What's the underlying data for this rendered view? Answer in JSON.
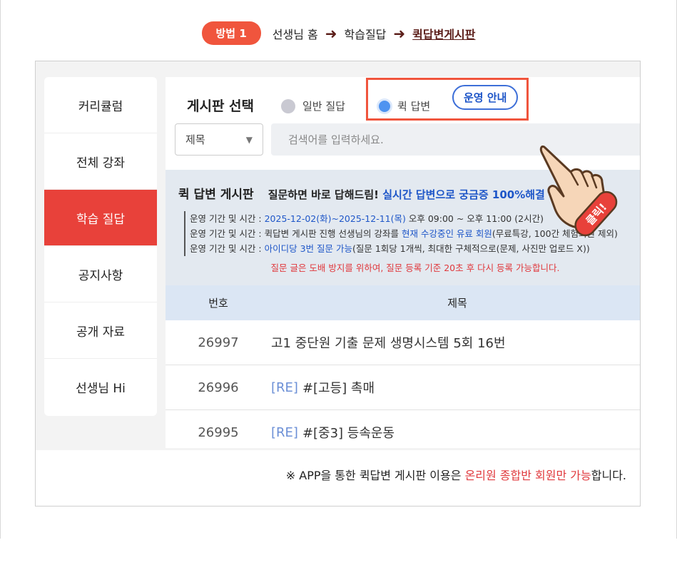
{
  "path": {
    "method_badge": "방법 1",
    "step1": "선생님 홈",
    "step2": "학습질답",
    "step3": "퀵답변게시판"
  },
  "sidebar": {
    "items": [
      {
        "label": "커리큘럼"
      },
      {
        "label": "전체 강좌"
      },
      {
        "label": "학습 질답"
      },
      {
        "label": "공지사항"
      },
      {
        "label": "공개 자료"
      },
      {
        "label": "선생님 Hi"
      }
    ]
  },
  "board_select": {
    "title": "게시판 선택",
    "radio_general": "일반 질답",
    "radio_quick": "퀵 답변",
    "guide_bubble": "운영 안내",
    "click_badge": "클릭!"
  },
  "search": {
    "field_value": "제목",
    "placeholder": "검색어를 입력하세요."
  },
  "info": {
    "title": "퀵 답변 게시판",
    "subtitle_plain": "질문하면 바로 답해드림!",
    "subtitle_blue": "실시간 답변으로 궁금증 100%해결",
    "line1_label": "운영 기간 및 시간 : ",
    "line1_blue": "2025-12-02(화)~2025-12-11(목)",
    "line1_rest": " 오후 09:00 ~ 오후 11:00 (2시간)",
    "line2_label": "운영 기간 및 시간 : ",
    "line2_plain": "퀵답변 게시판 진행 선생님의 강좌를 ",
    "line2_blue": "현재 수강중인 유료 회원",
    "line2_rest": "(무료특강, 100간 체험회원 제외)",
    "line3_label": "운영 기간 및 시간 : ",
    "line3_blue": "아이디당 3번 질문 가능",
    "line3_rest": "(질문 1회당 1개씩, 최대한 구체적으로(문제, 사진만 업로드 X))",
    "warning": "질문 글은 도배 방지를 위하여, 질문 등록 기준 20초 후 다시 등록 가능합니다."
  },
  "table": {
    "col_num": "번호",
    "col_title": "제목",
    "rows": [
      {
        "num": "26997",
        "prefix": "",
        "title": "고1 중단원 기출 문제 생명시스템 5회 16번"
      },
      {
        "num": "26996",
        "prefix": "[RE]",
        "title": "#[고등] 촉매"
      },
      {
        "num": "26995",
        "prefix": "[RE]",
        "title": "#[중3] 등속운동"
      }
    ]
  },
  "notice": {
    "prefix": "※ APP을 통한 퀵답변 게시판 이용은 ",
    "red": "온리원 종합반 회원만 가능",
    "suffix": "합니다."
  },
  "colors": {
    "accent_red": "#e8413a",
    "badge_orange": "#f0553d",
    "link_blue": "#1e56c8",
    "arrow_brown": "#5c1f1a"
  }
}
